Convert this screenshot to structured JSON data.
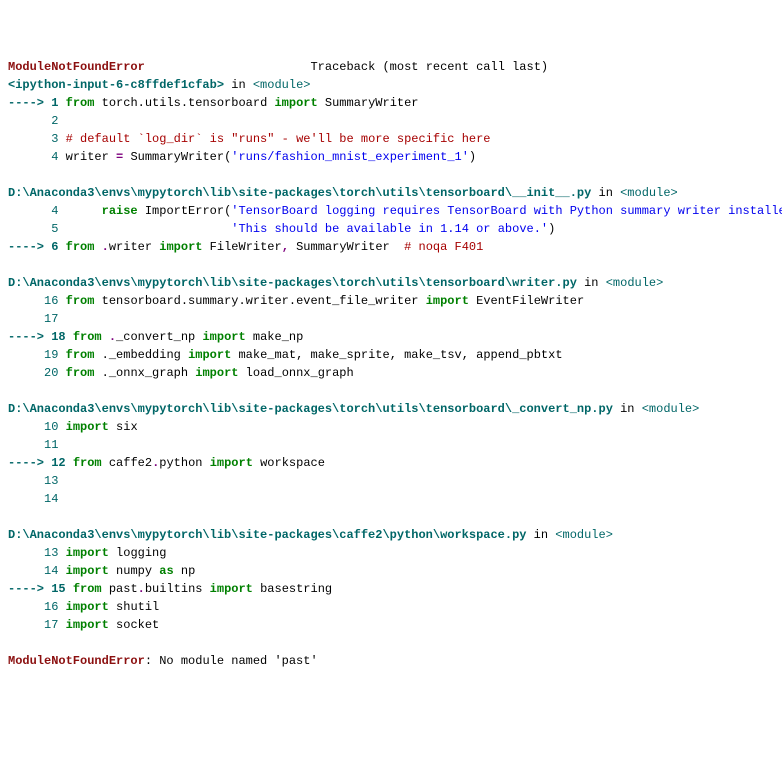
{
  "hdr": {
    "exc": "ModuleNotFoundError",
    "tb": "Traceback (most recent call last)"
  },
  "f0": {
    "loc": "<ipython-input-6-c8ffdef1cfab>",
    "in": " in ",
    "mod": "<module>",
    "l1no": "1",
    "l1a": "from",
    "l1b": " torch.utils.tensorboard ",
    "l1c": "import",
    "l1d": " SummaryWriter",
    "l2no": "2",
    "l3no": "3",
    "l3": "# default `log_dir` is \"runs\" - we'll be more specific here",
    "l4no": "4",
    "l4a": "writer ",
    "l4b": "=",
    "l4c": " SummaryWriter(",
    "l4d": "'runs/fashion_mnist_experiment_1'",
    "l4e": ")"
  },
  "f1": {
    "path": "D:\\Anaconda3\\envs\\mypytorch\\lib\\site-packages\\torch\\utils\\tensorboard\\__init__.py",
    "in": " in ",
    "mod": "<module>",
    "l4no": "4",
    "l4a": "     raise",
    "l4b": " ImportError",
    "l4c": "(",
    "l4d": "'TensorBoard logging requires TensorBoard with Python summary writer installed. '",
    "l5no": "5",
    "l5a": "                       ",
    "l5b": "'This should be available in 1.14 or above.'",
    "l5c": ")",
    "l6no": "6",
    "l6a": "from",
    "l6b": " ",
    "l6c": ".",
    "l6d": "writer ",
    "l6e": "import",
    "l6f": " FileWriter",
    "l6g": ",",
    "l6h": " SummaryWriter  ",
    "l6i": "# noqa F401"
  },
  "f2": {
    "path": "D:\\Anaconda3\\envs\\mypytorch\\lib\\site-packages\\torch\\utils\\tensorboard\\writer.py",
    "in": " in ",
    "mod": "<module>",
    "l16no": "16",
    "l16a": "from",
    "l16b": " tensorboard.summary.writer.event_file_writer ",
    "l16c": "import",
    "l16d": " EventFileWriter",
    "l17no": "17",
    "l18no": "18",
    "l18a": "from",
    "l18b": " ",
    "l18c": ".",
    "l18d": "_convert_np ",
    "l18e": "import",
    "l18f": " make_np",
    "l19no": "19",
    "l19a": "from",
    "l19b": " ._embedding ",
    "l19c": "import",
    "l19d": " make_mat, make_sprite, make_tsv, append_pbtxt",
    "l20no": "20",
    "l20a": "from",
    "l20b": " ._onnx_graph ",
    "l20c": "import",
    "l20d": " load_onnx_graph"
  },
  "f3": {
    "path": "D:\\Anaconda3\\envs\\mypytorch\\lib\\site-packages\\torch\\utils\\tensorboard\\_convert_np.py",
    "in": " in ",
    "mod": "<module>",
    "l10no": "10",
    "l10a": "import",
    "l10b": " six",
    "l11no": "11",
    "l12no": "12",
    "l12a": "from",
    "l12b": " caffe2",
    "l12c": ".",
    "l12d": "python ",
    "l12e": "import",
    "l12f": " workspace",
    "l13no": "13",
    "l14no": "14"
  },
  "f4": {
    "path": "D:\\Anaconda3\\envs\\mypytorch\\lib\\site-packages\\caffe2\\python\\workspace.py",
    "in": " in ",
    "mod": "<module>",
    "l13no": "13",
    "l13a": "import",
    "l13b": " logging",
    "l14no": "14",
    "l14a": "import",
    "l14b": " numpy ",
    "l14c": "as",
    "l14d": " np",
    "l15no": "15",
    "l15a": "from",
    "l15b": " past",
    "l15c": ".",
    "l15d": "builtins ",
    "l15e": "import",
    "l15f": " basestring",
    "l16no": "16",
    "l16a": "import",
    "l16b": " shutil",
    "l17no": "17",
    "l17a": "import",
    "l17b": " socket"
  },
  "final": {
    "exc": "ModuleNotFoundError",
    "msg": ": No module named 'past'"
  },
  "sym": {
    "arrow": "----> ",
    "sp6": "      ",
    "sp5": "     "
  }
}
